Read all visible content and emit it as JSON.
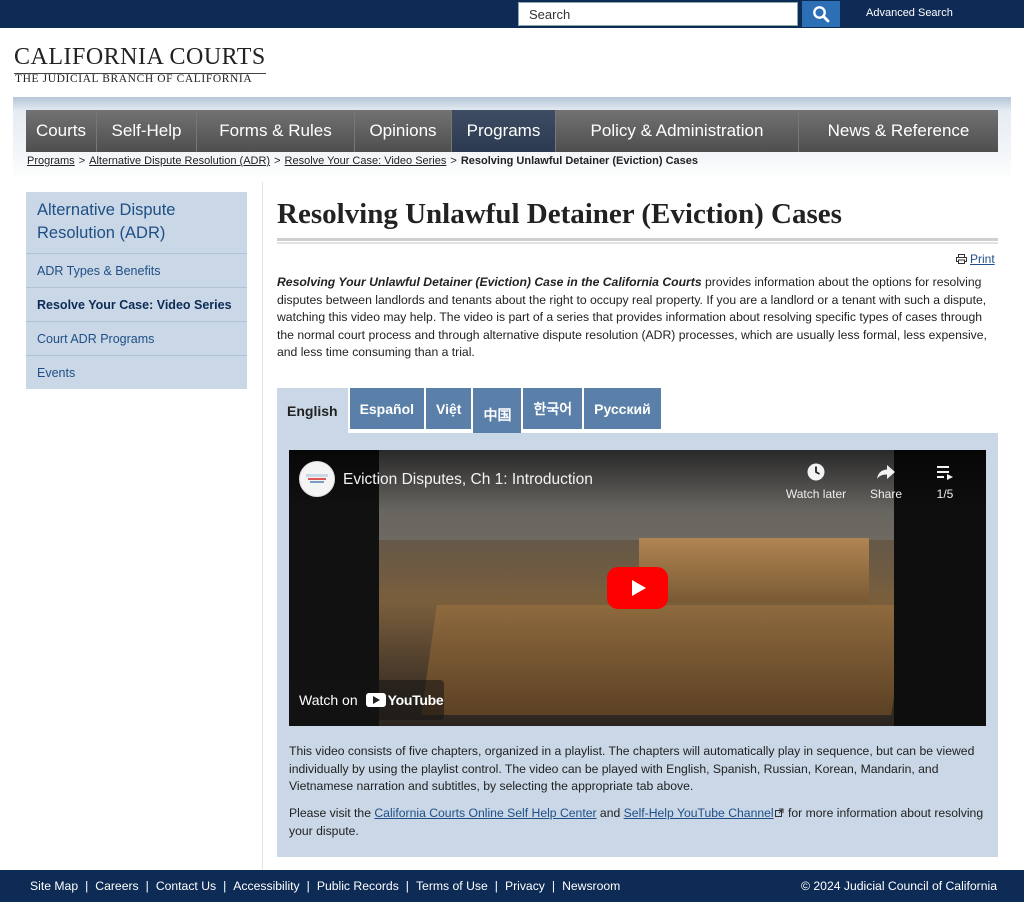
{
  "header": {
    "search_placeholder": "Search",
    "advanced_search": "Advanced Search",
    "logo_title": "CALIFORNIA COURTS",
    "logo_subtitle": "THE JUDICIAL BRANCH OF CALIFORNIA"
  },
  "nav": {
    "items": [
      {
        "label": "Courts"
      },
      {
        "label": "Self-Help"
      },
      {
        "label": "Forms & Rules"
      },
      {
        "label": "Opinions"
      },
      {
        "label": "Programs"
      },
      {
        "label": "Policy & Administration"
      },
      {
        "label": "News & Reference"
      }
    ],
    "active": "Programs"
  },
  "breadcrumb": {
    "items": [
      "Programs",
      "Alternative Dispute Resolution (ADR)",
      "Resolve Your Case: Video Series"
    ],
    "separator": ">",
    "current": "Resolving Unlawful Detainer (Eviction) Cases"
  },
  "sidebar": {
    "heading": "Alternative Dispute Resolution (ADR)",
    "items": [
      {
        "label": "ADR Types & Benefits"
      },
      {
        "label": "Resolve Your Case: Video Series"
      },
      {
        "label": "Court ADR Programs"
      },
      {
        "label": "Events"
      }
    ],
    "active": "Resolve Your Case: Video Series"
  },
  "main": {
    "title": "Resolving Unlawful Detainer (Eviction) Cases",
    "print_label": "Print",
    "intro_emphasis": "Resolving Your Unlawful Detainer (Eviction) Case in the California Courts",
    "intro_rest": " provides information about the options for resolving disputes between landlords and tenants about the right to occupy real property. If you are a landlord or a tenant with such a dispute, watching this video may help. The video is part of a series that provides information about resolving specific types of cases through the normal court process and through alternative dispute resolution (ADR) processes, which are usually less formal, less expensive, and less time consuming than a trial.",
    "tabs": [
      {
        "label": "English"
      },
      {
        "label": "Español"
      },
      {
        "label": "Việt"
      },
      {
        "label": "中国"
      },
      {
        "label": "한국어"
      },
      {
        "label": "Русский"
      }
    ],
    "active_tab": "English",
    "video": {
      "title": "Eviction Disputes, Ch 1: Introduction",
      "watch_later": "Watch later",
      "share": "Share",
      "playlist_count": "1/5",
      "watch_on": "Watch on",
      "youtube": "YouTube"
    },
    "description": "This video consists of five chapters, organized in a playlist. The chapters will automatically play in sequence, but can be viewed individually by using the playlist control. The video can be played with English, Spanish, Russian, Korean, Mandarin, and Vietnamese narration and subtitles, by selecting the appropriate tab above.",
    "visit_prefix": "Please visit the ",
    "link_self_help_center": "California Courts Online Self Help Center",
    "visit_and": " and ",
    "link_youtube_channel": "Self-Help YouTube Channel",
    "visit_suffix": " for more information about resolving your dispute."
  },
  "footer": {
    "links": [
      {
        "label": "Site Map"
      },
      {
        "label": "Careers"
      },
      {
        "label": "Contact Us"
      },
      {
        "label": "Accessibility"
      },
      {
        "label": "Public Records"
      },
      {
        "label": "Terms of Use"
      },
      {
        "label": "Privacy"
      },
      {
        "label": "Newsroom"
      }
    ],
    "separator": "|",
    "copyright": "© 2024 Judicial Council of California"
  },
  "colors": {
    "brand_navy": "#0d2b55",
    "accent_blue": "#2c6fb5",
    "panel_blue": "#c9d7e6",
    "tab_blue": "#5a7fa8",
    "youtube_red": "#ff0000"
  }
}
